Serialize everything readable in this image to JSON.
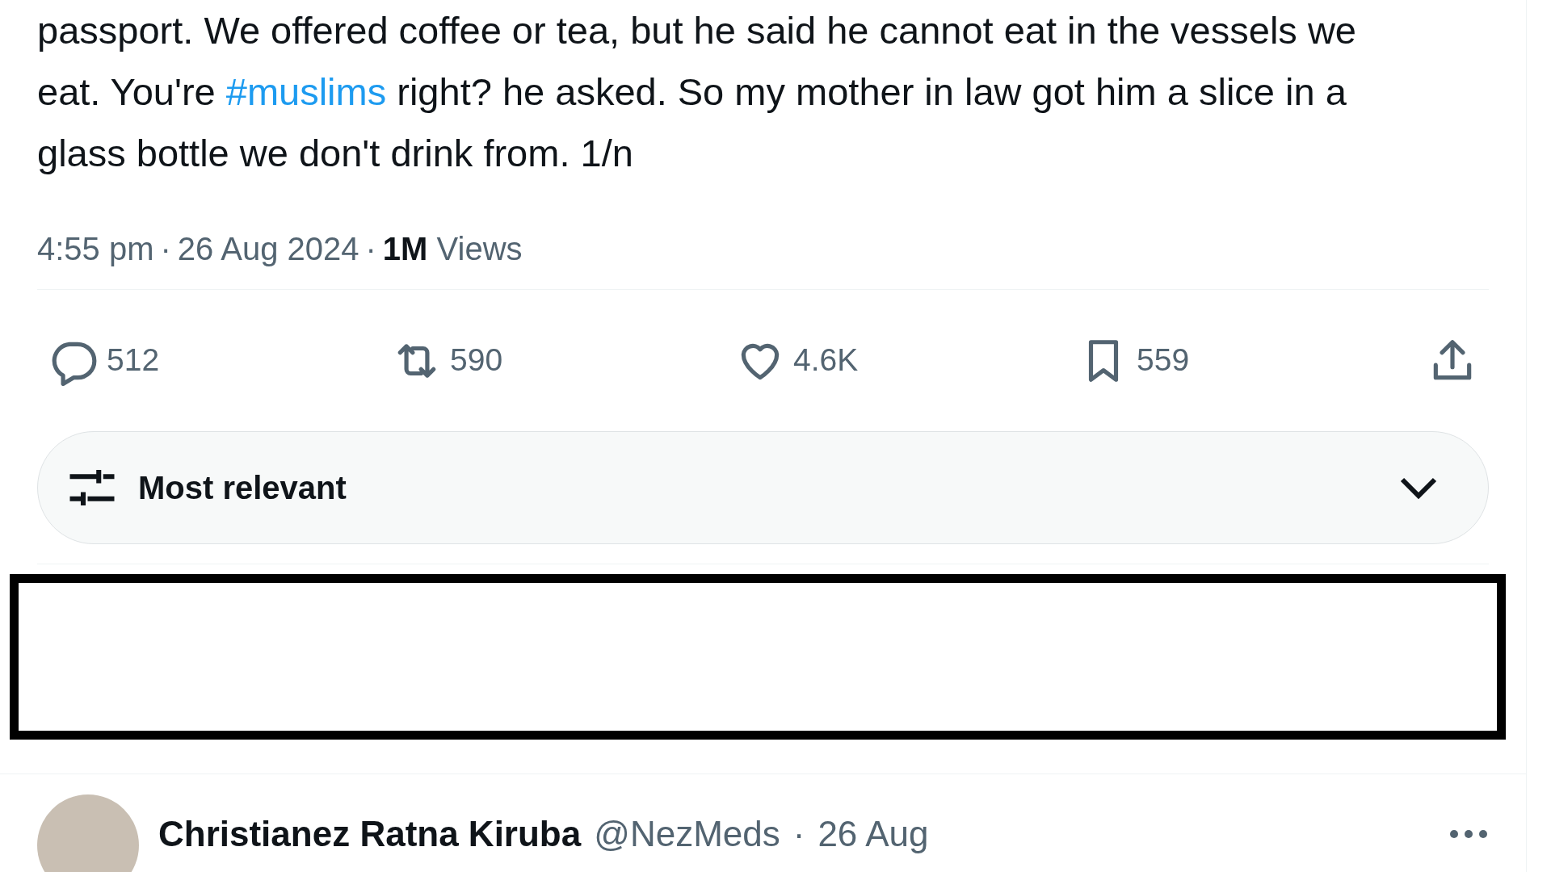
{
  "tweet": {
    "text_before": "passport. We offered coffee or tea, but he said he cannot eat in the vessels we eat. You're ",
    "hashtag": "#muslims",
    "text_after": " right? he asked. So my mother in law got him a slice in a glass bottle we don't drink from. 1/n",
    "meta": {
      "time": "4:55 pm",
      "separator": "·",
      "date": "26 Aug 2024",
      "views_count": "1M",
      "views_label": "Views"
    },
    "actions": [
      {
        "kind": "reply",
        "count": "512"
      },
      {
        "kind": "repost",
        "count": "590"
      },
      {
        "kind": "like",
        "count": "4.6K"
      },
      {
        "kind": "bookmark",
        "count": "559"
      },
      {
        "kind": "share"
      }
    ]
  },
  "sort": {
    "label": "Most relevant"
  },
  "reply": {
    "name": "Christianez Ratna Kiruba",
    "handle": "@NezMeds",
    "separator": "·",
    "date": "26 Aug"
  }
}
